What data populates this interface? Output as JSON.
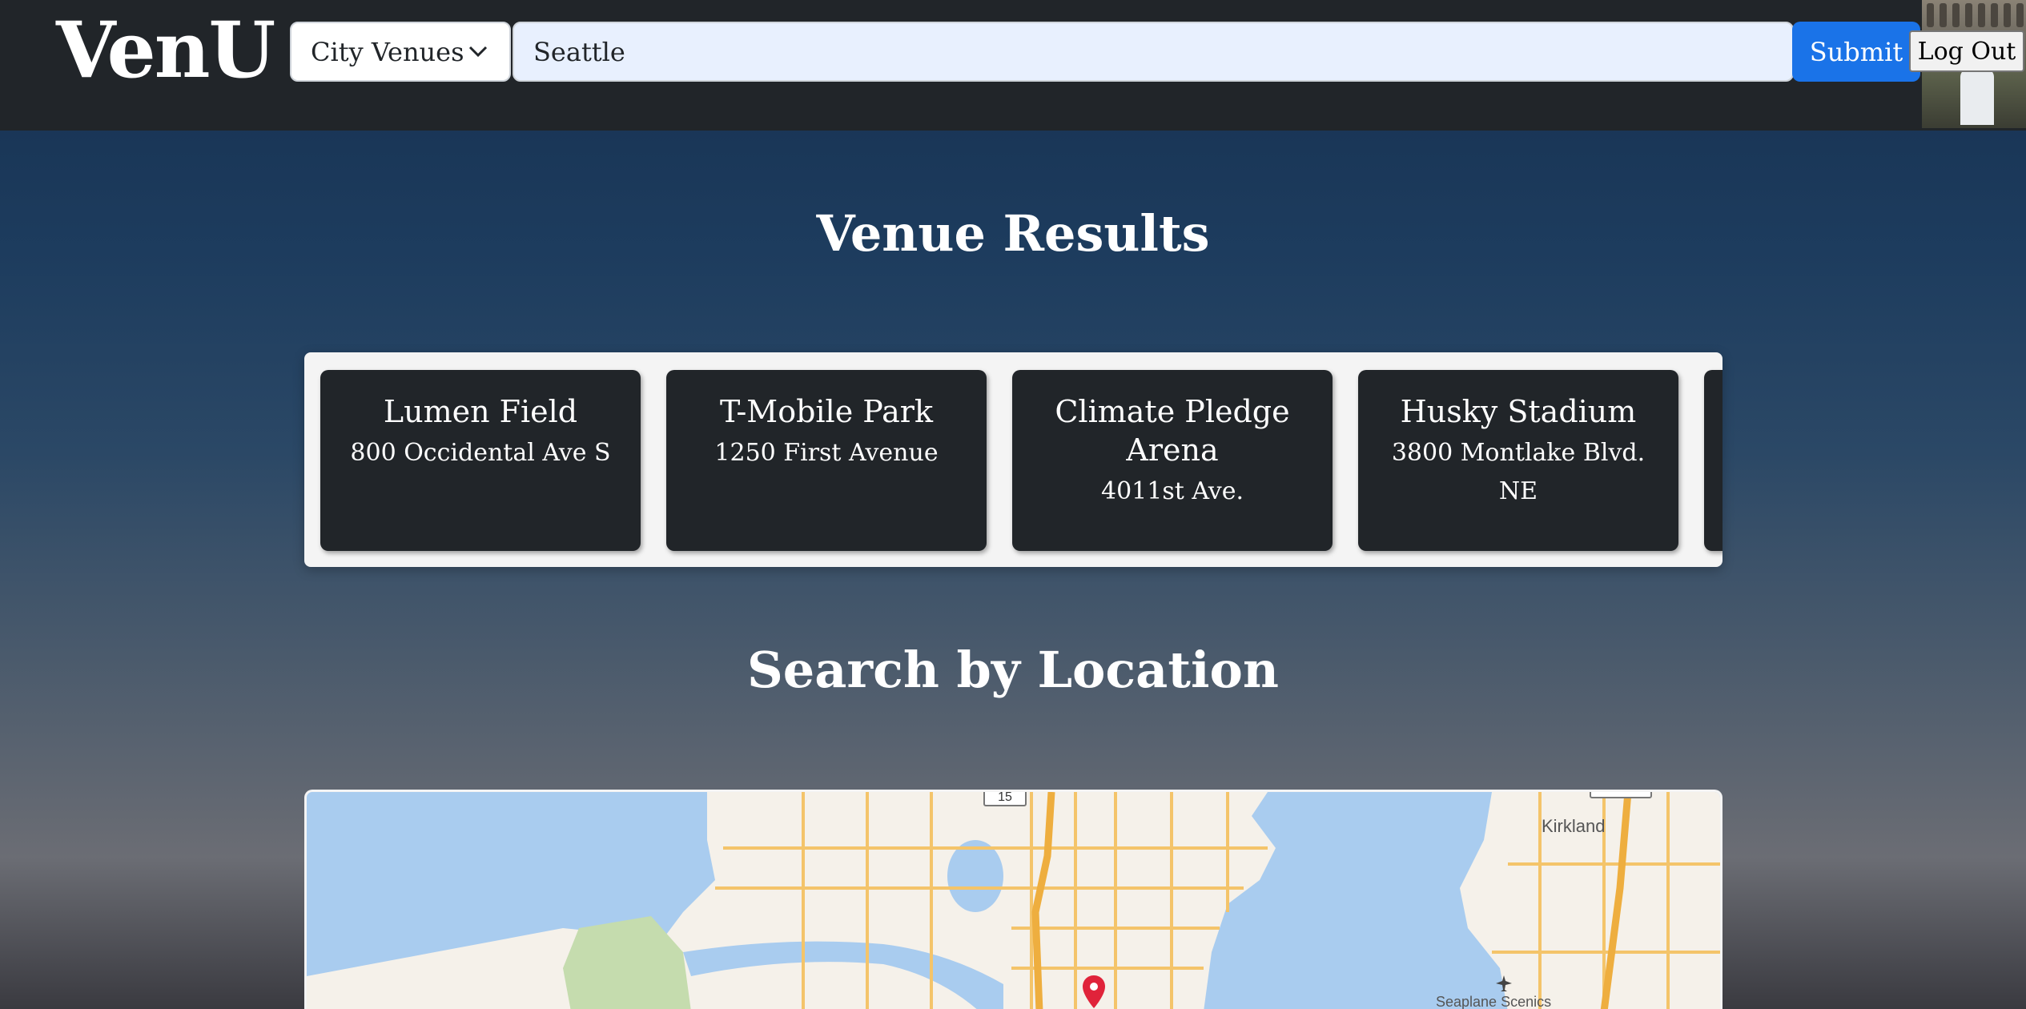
{
  "header": {
    "logo": "VenU",
    "category_select": {
      "value": "City Venues",
      "icon": "chevron-down-icon"
    },
    "search": {
      "value": "Seattle"
    },
    "submit_label": "Submit",
    "logout_label": "Log Out",
    "avatar": "user-avatar-photo"
  },
  "results": {
    "heading": "Venue Results",
    "venues": [
      {
        "name": "Lumen Field",
        "address": "800 Occidental Ave S"
      },
      {
        "name": "T-Mobile Park",
        "address": "1250 First Avenue"
      },
      {
        "name": "Climate Pledge Arena",
        "address": "4011st Ave."
      },
      {
        "name": "Husky Stadium",
        "address": "3800 Montlake Blvd. NE"
      }
    ]
  },
  "location": {
    "heading": "Search by Location",
    "map": {
      "labels": {
        "kirkland": "Kirkland",
        "seaplane": "Seaplane Scenics",
        "shield": "15"
      },
      "marker_icon": "map-pin-icon",
      "colors": {
        "water": "#a9ccef",
        "land": "#f5f1ea",
        "park": "#c5dcae",
        "roads": "#f4c46a",
        "marker": "#e0233a"
      }
    }
  }
}
